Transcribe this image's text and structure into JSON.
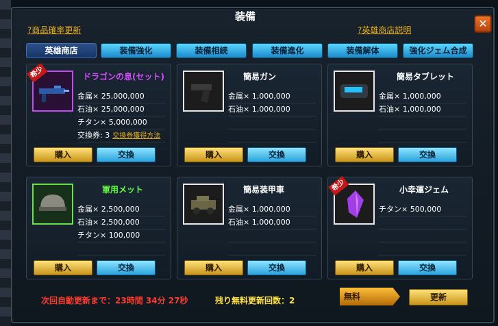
{
  "window": {
    "title": "装備",
    "close_label": "✕"
  },
  "header": {
    "probability_link": "?商品確率更新",
    "hero_shop_link": "?英雄商店説明"
  },
  "tabs": [
    {
      "label": "英雄商店",
      "active": true
    },
    {
      "label": "装備強化",
      "active": false
    },
    {
      "label": "装備相続",
      "active": false
    },
    {
      "label": "装備進化",
      "active": false
    },
    {
      "label": "装備解体",
      "active": false
    },
    {
      "label": "強化ジェム合成",
      "active": false
    }
  ],
  "cards": [
    {
      "name": "ドラゴンの息(セット)",
      "name_color": "#d64cff",
      "rare": true,
      "rare_label": "希少",
      "icon": "rifle-icon",
      "frame": "purple",
      "rows": [
        "金属× 25,000,000",
        "石油× 25,000,000",
        "チタン× 5,000,000",
        "交換券: 3"
      ],
      "exchange_link": "交換券獲得方法",
      "buy_label": "購入",
      "exchange_label": "交換"
    },
    {
      "name": "簡易ガン",
      "name_color": "#ffffff",
      "rare": false,
      "icon": "pistol-icon",
      "frame": "white",
      "rows": [
        "金属× 1,000,000",
        "石油× 1,000,000",
        "",
        ""
      ],
      "buy_label": "購入",
      "exchange_label": "交換"
    },
    {
      "name": "簡易タブレット",
      "name_color": "#ffffff",
      "rare": false,
      "icon": "tablet-icon",
      "frame": "white",
      "rows": [
        "金属× 1,000,000",
        "石油× 1,000,000",
        "",
        ""
      ],
      "buy_label": "購入",
      "exchange_label": "交換"
    },
    {
      "name": "軍用メット",
      "name_color": "#66ff44",
      "rare": false,
      "icon": "helmet-icon",
      "frame": "green",
      "rows": [
        "金属× 2,500,000",
        "石油× 2,500,000",
        "チタン× 100,000",
        ""
      ],
      "buy_label": "購入",
      "exchange_label": "交換"
    },
    {
      "name": "簡易装甲車",
      "name_color": "#ffffff",
      "rare": false,
      "icon": "armored-car-icon",
      "frame": "white",
      "rows": [
        "金属× 1,000,000",
        "石油× 1,000,000",
        "",
        ""
      ],
      "buy_label": "購入",
      "exchange_label": "交換"
    },
    {
      "name": "小幸運ジェム",
      "name_color": "#ffffff",
      "rare": true,
      "rare_label": "希少",
      "icon": "gem-icon",
      "frame": "white",
      "rows": [
        "チタン× 500,000",
        "",
        "",
        ""
      ],
      "buy_label": "購入",
      "exchange_label": "交換"
    }
  ],
  "footer": {
    "timer_text": "次回自動更新まで：23時間 34分 27秒",
    "free_refresh_text": "残り無料更新回数：2",
    "free_label": "無料",
    "refresh_label": "更新"
  }
}
